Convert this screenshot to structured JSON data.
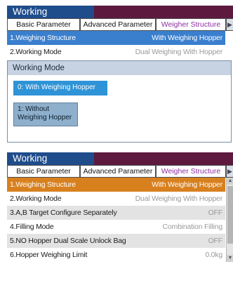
{
  "panel1": {
    "title": "Working Parameter",
    "tabs": [
      "Basic Parameter",
      "Advanced Parameter",
      "Weigher Structure"
    ],
    "tab_arrow": "▶",
    "rows": [
      {
        "label": "1.Weighing Structure",
        "value": "With Weighing Hopper"
      },
      {
        "label": "2.Working Mode",
        "value": "Dual Weighing With Hopper"
      }
    ],
    "popup": {
      "title": "Working Mode",
      "options": [
        "0: With Weighing Hopper",
        "1: Without Weighing Hopper"
      ],
      "selected_index": 0
    }
  },
  "panel2": {
    "title": "Working Parameter",
    "tabs": [
      "Basic Parameter",
      "Advanced Parameter",
      "Weigher Structure"
    ],
    "tab_arrow": "▶",
    "rows": [
      {
        "label": "1.Weighing Structure",
        "value": "With Weighing Hopper"
      },
      {
        "label": "2.Working Mode",
        "value": "Dual Weighing With Hopper"
      },
      {
        "label": "3.A,B Target Configure Separately",
        "value": "OFF"
      },
      {
        "label": "4.Filling Mode",
        "value": "Combination Filling"
      },
      {
        "label": "5.NO Hopper Dual Scale Unlock Bag",
        "value": "OFF"
      },
      {
        "label": "6.Hopper Weighing Limit",
        "value": "0.0kg"
      }
    ],
    "scroll_up": "▲",
    "scroll_down": "▼"
  },
  "colors": {
    "title_bg": "#1f4c8b",
    "title_bar": "#5d1a3e",
    "selected_blue": "#3a7fce",
    "selected_orange": "#d8801e",
    "active_tab_text": "#8c2ea0"
  }
}
